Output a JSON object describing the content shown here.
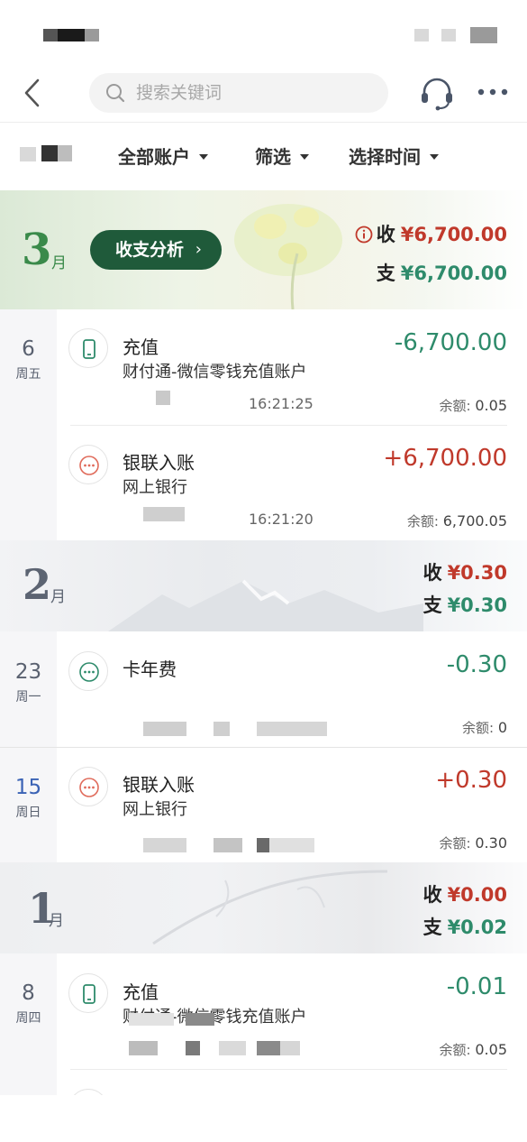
{
  "search": {
    "placeholder": "搜索关键词"
  },
  "filters": {
    "account": "全部账户",
    "filter": "筛选",
    "time": "选择时间"
  },
  "months": [
    {
      "num": "3",
      "unit": "月",
      "analysis_label": "收支分析",
      "income_label": "收",
      "income": "¥6,700.00",
      "expense_label": "支",
      "expense": "¥6,700.00"
    },
    {
      "num": "2",
      "unit": "月",
      "income_label": "收",
      "income": "¥0.30",
      "expense_label": "支",
      "expense": "¥0.30"
    },
    {
      "num": "1",
      "unit": "月",
      "income_label": "收",
      "income": "¥0.00",
      "expense_label": "支",
      "expense": "¥0.02"
    }
  ],
  "days": [
    {
      "day": "6",
      "weekday": "周五"
    },
    {
      "day": "23",
      "weekday": "周一"
    },
    {
      "day": "15",
      "weekday": "周日"
    },
    {
      "day": "8",
      "weekday": "周四"
    }
  ],
  "transactions": [
    {
      "title": "充值",
      "subtitle": "财付通-微信零钱充值账户",
      "amount": "-6,700.00",
      "time": "16:21:25",
      "balance_label": "余额:",
      "balance": "0.05",
      "icon": "phone-icon"
    },
    {
      "title": "银联入账",
      "subtitle": "网上银行",
      "amount": "+6,700.00",
      "time": "16:21:20",
      "balance_label": "余额:",
      "balance": "6,700.05",
      "icon": "more-dots-icon"
    },
    {
      "title": "卡年费",
      "subtitle": "",
      "amount": "-0.30",
      "time": "",
      "balance_label": "余额:",
      "balance": "0",
      "icon": "more-dots-icon"
    },
    {
      "title": "银联入账",
      "subtitle": "网上银行",
      "amount": "+0.30",
      "time": "",
      "balance_label": "余额:",
      "balance": "0.30",
      "icon": "more-dots-icon"
    },
    {
      "title": "充值",
      "subtitle": "财付通-微信零钱充值账户",
      "amount": "-0.01",
      "time": "",
      "balance_label": "余额:",
      "balance": "0.05",
      "icon": "phone-icon"
    }
  ],
  "colors": {
    "income": "#c0392b",
    "expense": "#2e8b6b",
    "analysis_button": "#1f5a3a"
  }
}
